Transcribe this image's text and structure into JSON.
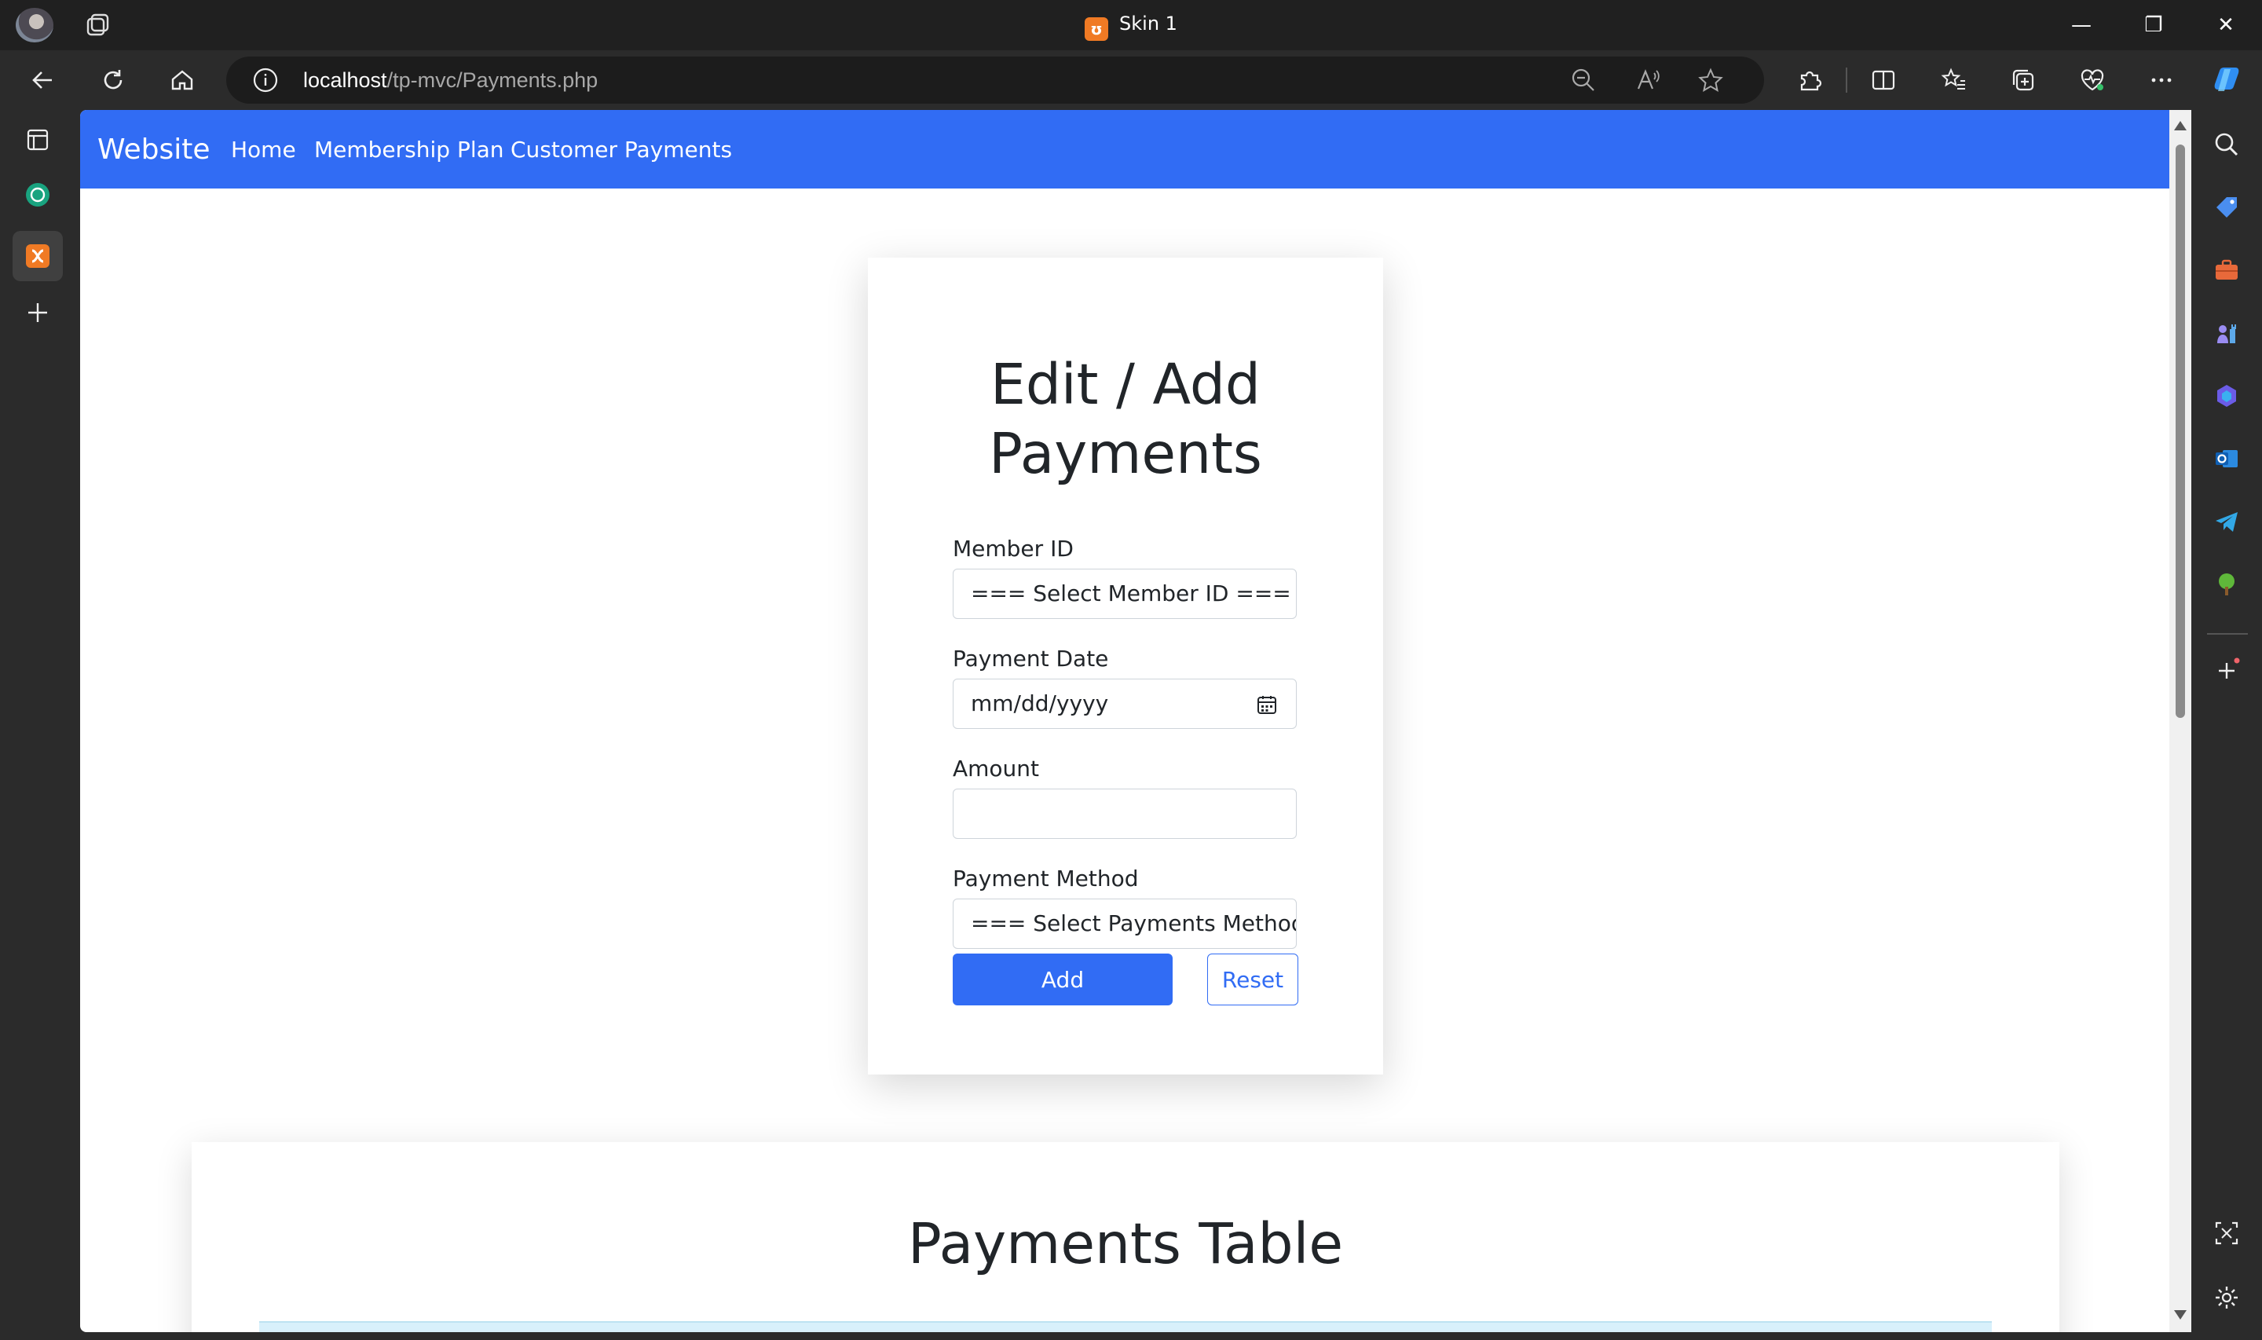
{
  "window": {
    "title": "Skin 1",
    "controls": {
      "minimize": "—",
      "restore": "❐",
      "close": "✕"
    }
  },
  "address_bar": {
    "host": "localhost",
    "path": "/tp-mvc/Payments.php"
  },
  "site_nav": {
    "brand": "Website",
    "links": [
      "Home",
      "Membership Plan",
      "Customer Payments"
    ],
    "color": "#316cf4"
  },
  "form": {
    "title": "Edit / Add Payments",
    "member_id": {
      "label": "Member ID",
      "value": "=== Select Member ID ==="
    },
    "payment_date": {
      "label": "Payment Date",
      "placeholder": "mm/dd/yyyy"
    },
    "amount": {
      "label": "Amount",
      "value": ""
    },
    "payment_method": {
      "label": "Payment Method",
      "value": "=== Select Payments Method ==="
    },
    "add_label": "Add",
    "reset_label": "Reset"
  },
  "table_section": {
    "title": "Payments Table"
  }
}
